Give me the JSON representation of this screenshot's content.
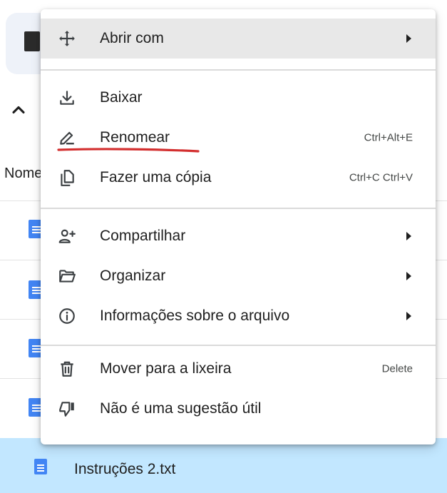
{
  "file_list": {
    "column_header": "Nome",
    "selected_file": {
      "name": "Instruções 2.txt"
    }
  },
  "context_menu": {
    "groups": [
      [
        {
          "id": "open-with",
          "label": "Abrir com",
          "icon": "move-arrows-icon",
          "submenu": true,
          "highlighted": true
        }
      ],
      [
        {
          "id": "download",
          "label": "Baixar",
          "icon": "download-icon"
        },
        {
          "id": "rename",
          "label": "Renomear",
          "icon": "pencil-icon",
          "shortcut": "Ctrl+Alt+E",
          "annotated": true
        },
        {
          "id": "make-copy",
          "label": "Fazer uma cópia",
          "icon": "copy-icon",
          "shortcut": "Ctrl+C Ctrl+V"
        }
      ],
      [
        {
          "id": "share",
          "label": "Compartilhar",
          "icon": "person-add-icon",
          "submenu": true
        },
        {
          "id": "organize",
          "label": "Organizar",
          "icon": "folder-open-icon",
          "submenu": true
        },
        {
          "id": "file-info",
          "label": "Informações sobre o arquivo",
          "icon": "info-icon",
          "submenu": true
        }
      ],
      [
        {
          "id": "trash",
          "label": "Mover para a lixeira",
          "icon": "trash-icon",
          "shortcut": "Delete"
        },
        {
          "id": "not-useful",
          "label": "Não é uma sugestão útil",
          "icon": "thumb-down-icon"
        }
      ]
    ]
  },
  "colors": {
    "highlight_row": "#e8e8e8",
    "selected_file_row": "#c2e7ff",
    "annotation": "#d32f2f",
    "doc_icon": "#4285f4"
  }
}
